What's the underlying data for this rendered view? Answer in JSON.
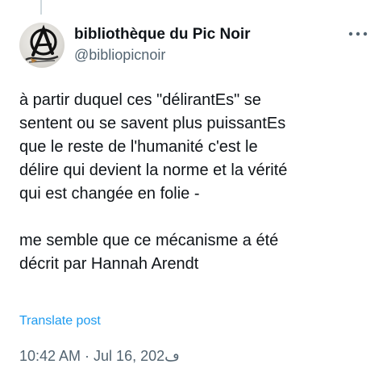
{
  "post": {
    "author": {
      "display_name": "bibliothèque du Pic Noir",
      "handle": "@bibliopicnoir"
    },
    "more_icon": "more-horizontal-icon",
    "text": "à partir duquel ces \"délirantEs\" se\nsentent ou se savent plus puissantEs\nque le reste de l'humanité  c'est le\ndélire qui devient la norme et la vérité\nqui est changée en folie -\n\nme semble que ce mécanisme a été\ndécrit par Hannah Arendt",
    "translate_label": "Translate post",
    "timestamp": "10:42 AM · Jul 16, 202ڡ"
  },
  "colors": {
    "text": "#0f1419",
    "secondary": "#536471",
    "link": "#1d9bf0"
  }
}
